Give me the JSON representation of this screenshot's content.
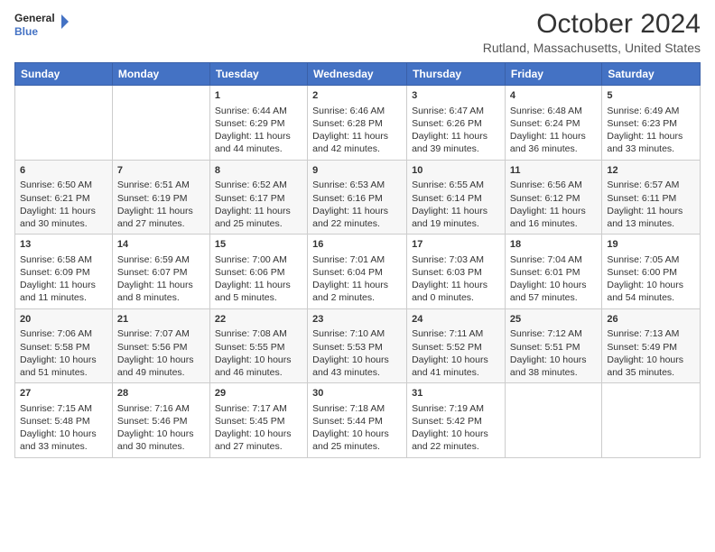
{
  "logo": {
    "line1": "General",
    "line2": "Blue"
  },
  "title": {
    "month_year": "October 2024",
    "location": "Rutland, Massachusetts, United States"
  },
  "days_of_week": [
    "Sunday",
    "Monday",
    "Tuesday",
    "Wednesday",
    "Thursday",
    "Friday",
    "Saturday"
  ],
  "weeks": [
    [
      {
        "day": "",
        "content": ""
      },
      {
        "day": "",
        "content": ""
      },
      {
        "day": "1",
        "content": "Sunrise: 6:44 AM\nSunset: 6:29 PM\nDaylight: 11 hours and 44 minutes."
      },
      {
        "day": "2",
        "content": "Sunrise: 6:46 AM\nSunset: 6:28 PM\nDaylight: 11 hours and 42 minutes."
      },
      {
        "day": "3",
        "content": "Sunrise: 6:47 AM\nSunset: 6:26 PM\nDaylight: 11 hours and 39 minutes."
      },
      {
        "day": "4",
        "content": "Sunrise: 6:48 AM\nSunset: 6:24 PM\nDaylight: 11 hours and 36 minutes."
      },
      {
        "day": "5",
        "content": "Sunrise: 6:49 AM\nSunset: 6:23 PM\nDaylight: 11 hours and 33 minutes."
      }
    ],
    [
      {
        "day": "6",
        "content": "Sunrise: 6:50 AM\nSunset: 6:21 PM\nDaylight: 11 hours and 30 minutes."
      },
      {
        "day": "7",
        "content": "Sunrise: 6:51 AM\nSunset: 6:19 PM\nDaylight: 11 hours and 27 minutes."
      },
      {
        "day": "8",
        "content": "Sunrise: 6:52 AM\nSunset: 6:17 PM\nDaylight: 11 hours and 25 minutes."
      },
      {
        "day": "9",
        "content": "Sunrise: 6:53 AM\nSunset: 6:16 PM\nDaylight: 11 hours and 22 minutes."
      },
      {
        "day": "10",
        "content": "Sunrise: 6:55 AM\nSunset: 6:14 PM\nDaylight: 11 hours and 19 minutes."
      },
      {
        "day": "11",
        "content": "Sunrise: 6:56 AM\nSunset: 6:12 PM\nDaylight: 11 hours and 16 minutes."
      },
      {
        "day": "12",
        "content": "Sunrise: 6:57 AM\nSunset: 6:11 PM\nDaylight: 11 hours and 13 minutes."
      }
    ],
    [
      {
        "day": "13",
        "content": "Sunrise: 6:58 AM\nSunset: 6:09 PM\nDaylight: 11 hours and 11 minutes."
      },
      {
        "day": "14",
        "content": "Sunrise: 6:59 AM\nSunset: 6:07 PM\nDaylight: 11 hours and 8 minutes."
      },
      {
        "day": "15",
        "content": "Sunrise: 7:00 AM\nSunset: 6:06 PM\nDaylight: 11 hours and 5 minutes."
      },
      {
        "day": "16",
        "content": "Sunrise: 7:01 AM\nSunset: 6:04 PM\nDaylight: 11 hours and 2 minutes."
      },
      {
        "day": "17",
        "content": "Sunrise: 7:03 AM\nSunset: 6:03 PM\nDaylight: 11 hours and 0 minutes."
      },
      {
        "day": "18",
        "content": "Sunrise: 7:04 AM\nSunset: 6:01 PM\nDaylight: 10 hours and 57 minutes."
      },
      {
        "day": "19",
        "content": "Sunrise: 7:05 AM\nSunset: 6:00 PM\nDaylight: 10 hours and 54 minutes."
      }
    ],
    [
      {
        "day": "20",
        "content": "Sunrise: 7:06 AM\nSunset: 5:58 PM\nDaylight: 10 hours and 51 minutes."
      },
      {
        "day": "21",
        "content": "Sunrise: 7:07 AM\nSunset: 5:56 PM\nDaylight: 10 hours and 49 minutes."
      },
      {
        "day": "22",
        "content": "Sunrise: 7:08 AM\nSunset: 5:55 PM\nDaylight: 10 hours and 46 minutes."
      },
      {
        "day": "23",
        "content": "Sunrise: 7:10 AM\nSunset: 5:53 PM\nDaylight: 10 hours and 43 minutes."
      },
      {
        "day": "24",
        "content": "Sunrise: 7:11 AM\nSunset: 5:52 PM\nDaylight: 10 hours and 41 minutes."
      },
      {
        "day": "25",
        "content": "Sunrise: 7:12 AM\nSunset: 5:51 PM\nDaylight: 10 hours and 38 minutes."
      },
      {
        "day": "26",
        "content": "Sunrise: 7:13 AM\nSunset: 5:49 PM\nDaylight: 10 hours and 35 minutes."
      }
    ],
    [
      {
        "day": "27",
        "content": "Sunrise: 7:15 AM\nSunset: 5:48 PM\nDaylight: 10 hours and 33 minutes."
      },
      {
        "day": "28",
        "content": "Sunrise: 7:16 AM\nSunset: 5:46 PM\nDaylight: 10 hours and 30 minutes."
      },
      {
        "day": "29",
        "content": "Sunrise: 7:17 AM\nSunset: 5:45 PM\nDaylight: 10 hours and 27 minutes."
      },
      {
        "day": "30",
        "content": "Sunrise: 7:18 AM\nSunset: 5:44 PM\nDaylight: 10 hours and 25 minutes."
      },
      {
        "day": "31",
        "content": "Sunrise: 7:19 AM\nSunset: 5:42 PM\nDaylight: 10 hours and 22 minutes."
      },
      {
        "day": "",
        "content": ""
      },
      {
        "day": "",
        "content": ""
      }
    ]
  ]
}
